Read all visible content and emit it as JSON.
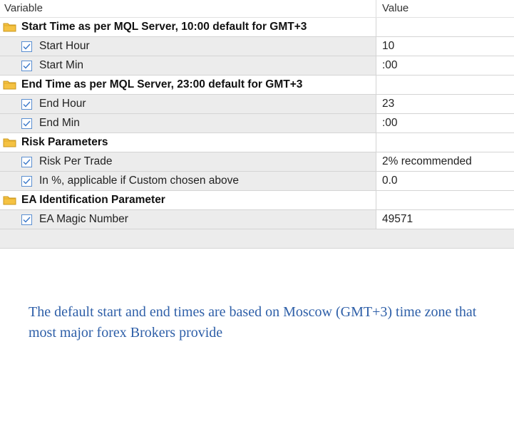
{
  "header": {
    "variable": "Variable",
    "value": "Value"
  },
  "groups": [
    {
      "title": "Start Time as per MQL Server, 10:00 default for GMT+3",
      "params": [
        {
          "name": "Start Hour",
          "value": "10"
        },
        {
          "name": "Start Min",
          "value": ":00"
        }
      ]
    },
    {
      "title": "End Time as per MQL Server, 23:00 default for GMT+3",
      "params": [
        {
          "name": "End Hour",
          "value": "23"
        },
        {
          "name": "End Min",
          "value": ":00"
        }
      ]
    },
    {
      "title": "Risk Parameters",
      "params": [
        {
          "name": "Risk Per Trade",
          "value": "2% recommended"
        },
        {
          "name": "In %, applicable if Custom chosen above",
          "value": "0.0"
        }
      ]
    },
    {
      "title": "EA Identification Parameter",
      "params": [
        {
          "name": "EA Magic Number",
          "value": "49571"
        }
      ]
    }
  ],
  "note": "The default start and end times are based on Moscow (GMT+3) time zone that most major forex Brokers provide",
  "icons": {
    "group": "folder-icon",
    "param": "checkbox-checked-icon"
  },
  "colors": {
    "folder": "#f5c242",
    "check": "#3a78c9",
    "note_text": "#2e5fa8"
  }
}
